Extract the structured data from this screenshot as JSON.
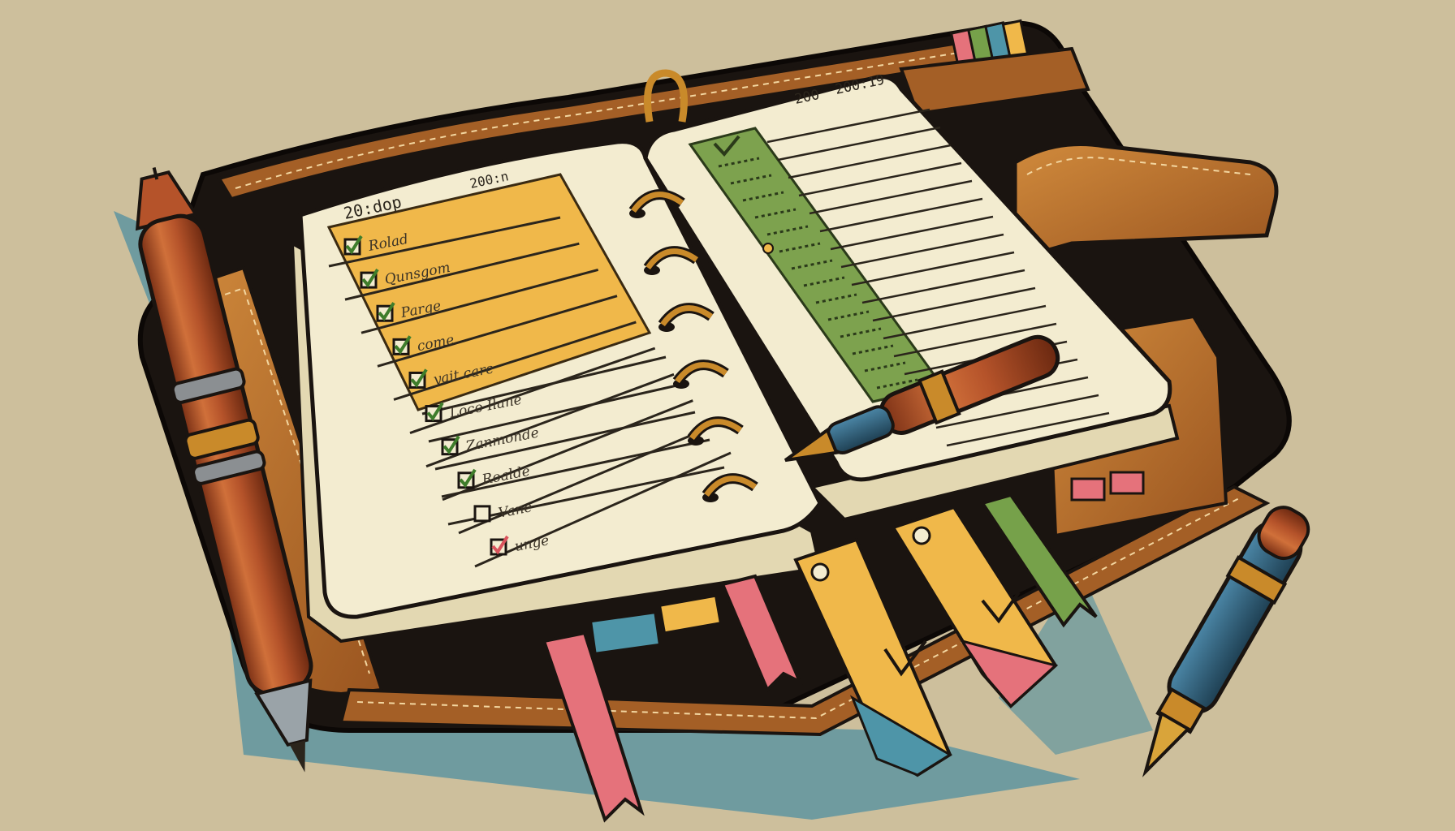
{
  "palette": {
    "background": "#cdbf9c",
    "leather_dark": "#1a1410",
    "leather_tan": "#b86f2c",
    "paper": "#f3ecd0",
    "yellow_highlight": "#f0b84a",
    "green_column": "#7da24e",
    "ink": "#2b251c",
    "pen_copper": "#b5532a",
    "pen_blue": "#2f5f7a",
    "ribbon_pink": "#e5727b",
    "ribbon_yellow": "#f0b84a",
    "ribbon_green": "#76a14a",
    "ribbon_blue": "#4e95a8"
  },
  "left_page": {
    "date_left": "20:dop",
    "date_right": "200:n",
    "tasks": [
      {
        "text": "Rolad",
        "done": true,
        "check_color": "#3f7d2b"
      },
      {
        "text": "Qunsgom",
        "done": true,
        "check_color": "#3f7d2b"
      },
      {
        "text": "Parge",
        "done": true,
        "check_color": "#3f7d2b"
      },
      {
        "text": "come",
        "done": true,
        "check_color": "#3f7d2b"
      },
      {
        "text": "yait care",
        "done": true,
        "check_color": "#3f7d2b"
      },
      {
        "text": "Loco  Ilane",
        "done": true,
        "check_color": "#3f7d2b"
      },
      {
        "text": "Zanmonde",
        "done": true,
        "check_color": "#3f7d2b"
      },
      {
        "text": "Roalde",
        "done": true,
        "check_color": "#3f7d2b"
      },
      {
        "text": "Vane",
        "done": false,
        "check_color": "#d9535c"
      },
      {
        "text": "unge",
        "done": true,
        "check_color": "#d9535c"
      }
    ]
  },
  "right_page": {
    "date_left": "200",
    "date_right": "200:19"
  },
  "icons": [
    "fountain-pen-icon",
    "ballpoint-pen-icon",
    "binder-ring-icon",
    "bookmark-ribbon-icon",
    "checkbox-icon"
  ]
}
